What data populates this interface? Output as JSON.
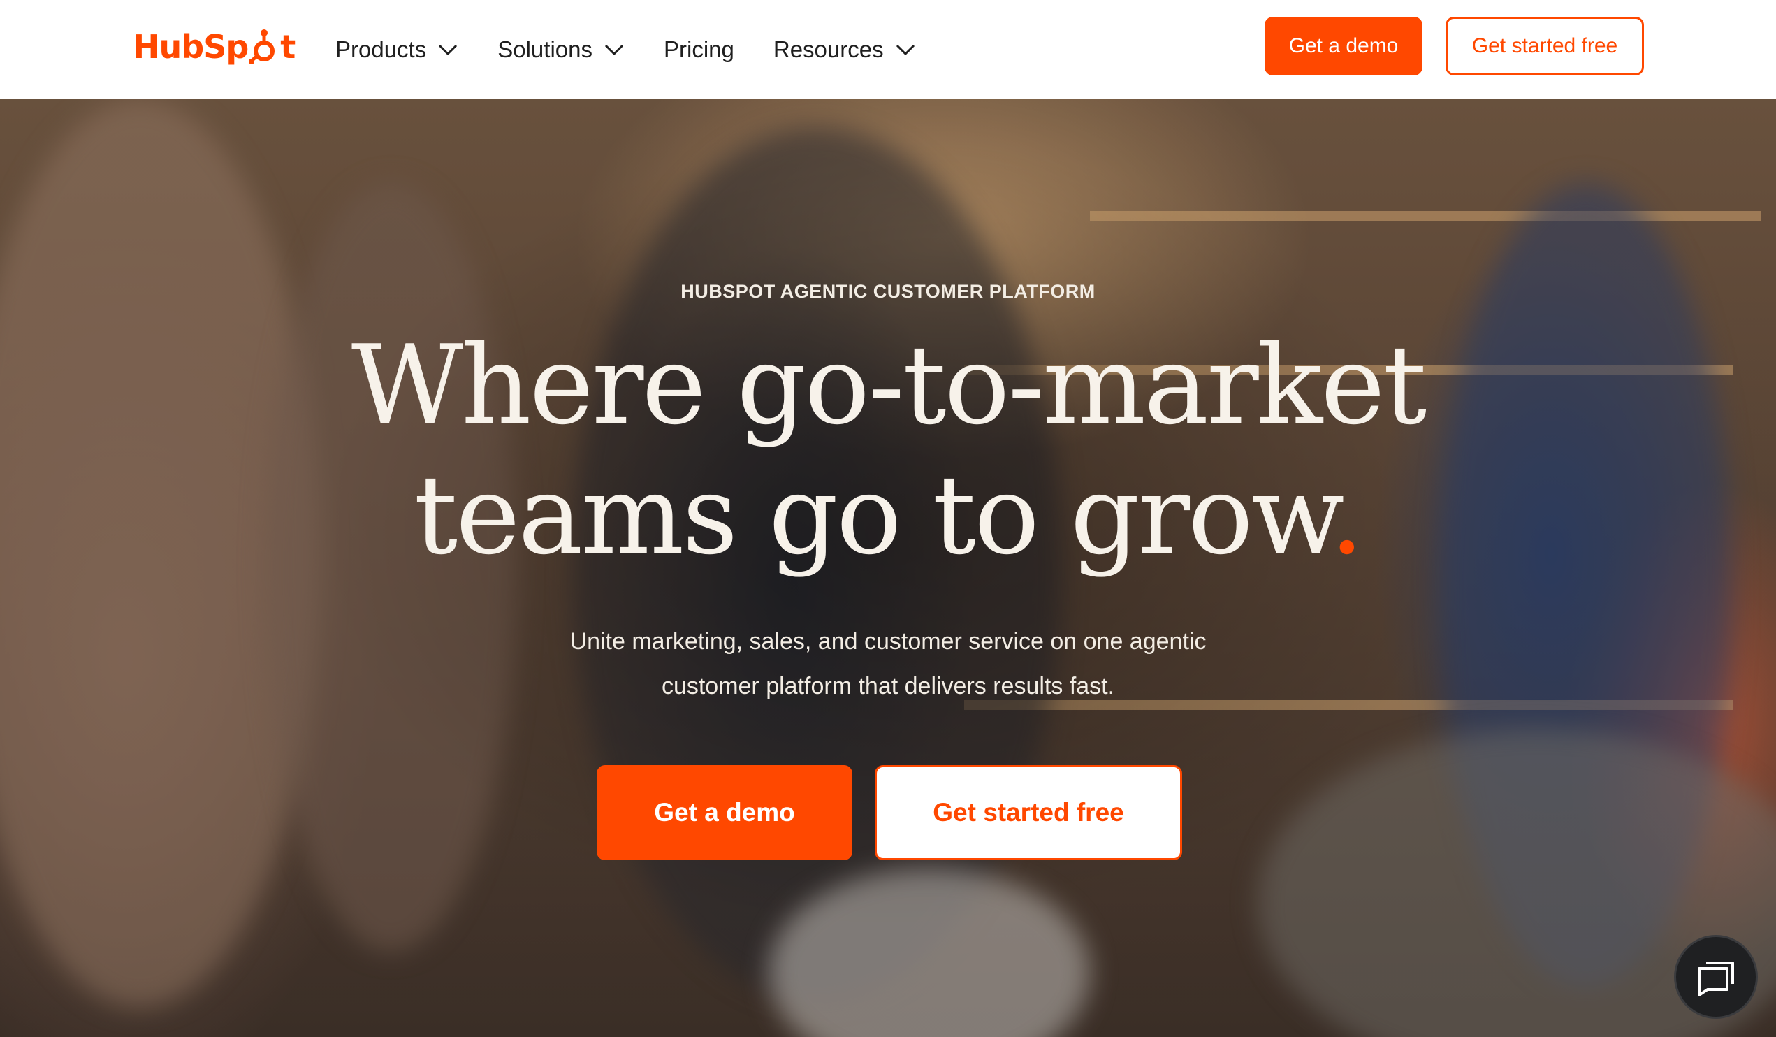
{
  "brand": {
    "name": "HubSpot",
    "accent_color": "#ff4800"
  },
  "nav": {
    "items": [
      {
        "label": "Products",
        "has_dropdown": true
      },
      {
        "label": "Solutions",
        "has_dropdown": true
      },
      {
        "label": "Pricing",
        "has_dropdown": false
      },
      {
        "label": "Resources",
        "has_dropdown": true
      }
    ]
  },
  "header": {
    "demo_label": "Get a demo",
    "free_label": "Get started free"
  },
  "hero": {
    "eyebrow": "HUBSPOT AGENTIC CUSTOMER PLATFORM",
    "headline_line1": "Where go-to-market",
    "headline_line2": "teams go to grow",
    "headline_dot": ".",
    "subtext_line1": "Unite marketing, sales, and customer service on one agentic",
    "subtext_line2": "customer platform that delivers results fast.",
    "demo_label": "Get a demo",
    "free_label": "Get started free"
  },
  "chat": {
    "icon": "chat-icon"
  }
}
